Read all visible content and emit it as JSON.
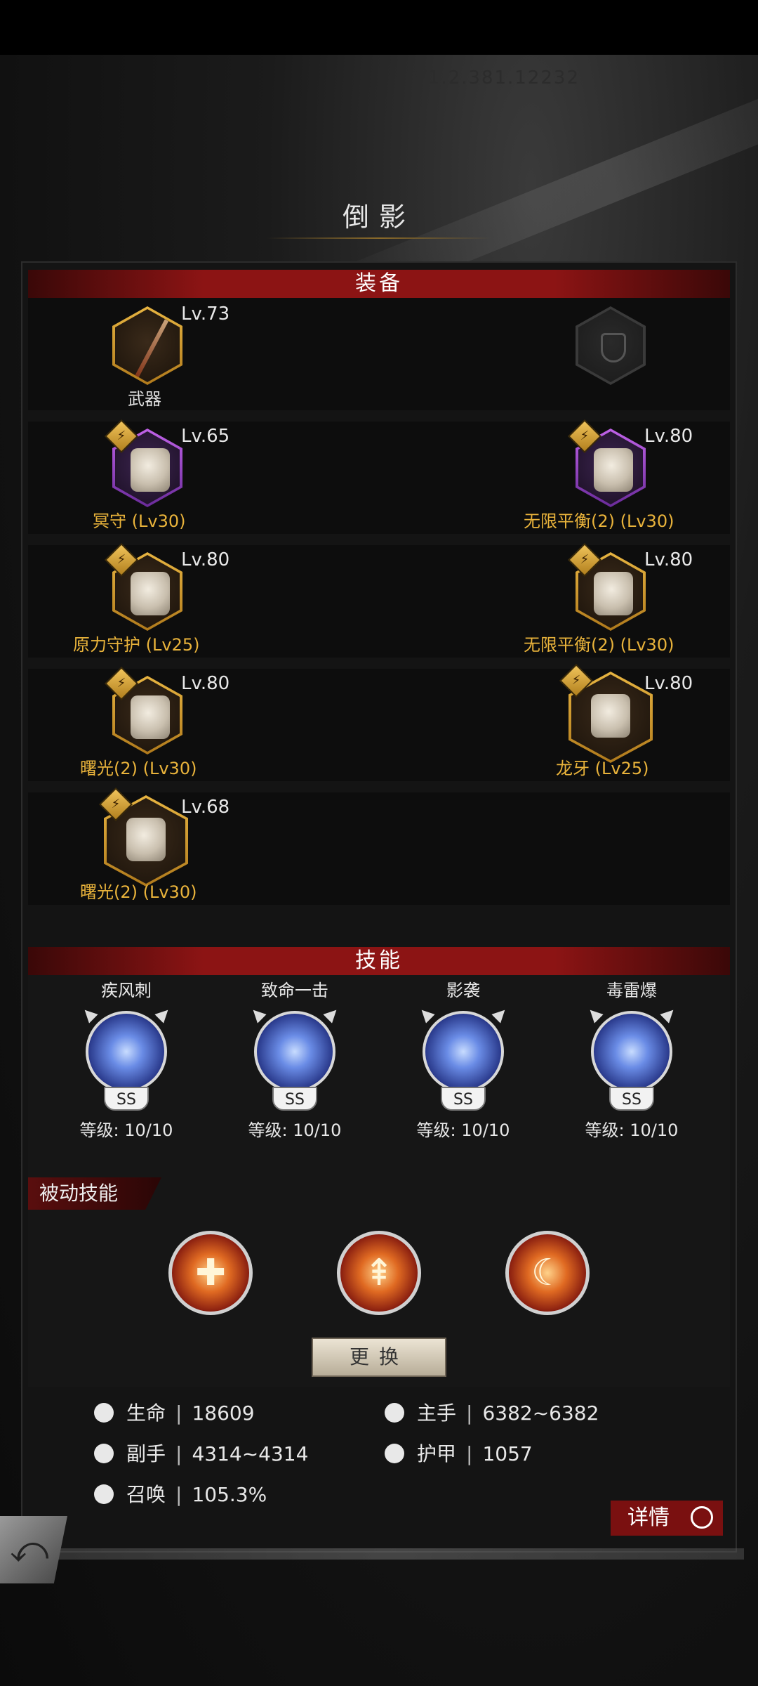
{
  "header": {
    "faint_text": "V1.2.381.12232",
    "title": "倒影"
  },
  "equipment": {
    "header": "装备",
    "slots": [
      {
        "level": "Lv.73",
        "name": "武器",
        "rarity": "gold",
        "icon": "katana-weapon"
      },
      {
        "level": "",
        "name": "",
        "rarity": "empty",
        "icon": "shield-slot-icon"
      },
      {
        "level": "Lv.65",
        "name": "冥守 (Lv30)",
        "rarity": "purple",
        "icon": "helmet"
      },
      {
        "level": "Lv.80",
        "name": "无限平衡(2) (Lv30)",
        "rarity": "purple",
        "icon": "chest-armor"
      },
      {
        "level": "Lv.80",
        "name": "原力守护 (Lv25)",
        "rarity": "gold",
        "icon": "gauntlet"
      },
      {
        "level": "Lv.80",
        "name": "无限平衡(2) (Lv30)",
        "rarity": "gold",
        "icon": "leg-armor"
      },
      {
        "level": "Lv.80",
        "name": "曙光(2) (Lv30)",
        "rarity": "gold",
        "icon": "necklace"
      },
      {
        "level": "Lv.80",
        "name": "龙牙 (Lv25)",
        "rarity": "gold",
        "icon": "belt"
      },
      {
        "level": "Lv.68",
        "name": "曙光(2) (Lv30)",
        "rarity": "gold",
        "icon": "cape"
      }
    ]
  },
  "skills": {
    "header": "技能",
    "active": [
      {
        "name": "疾风刺",
        "grade": "SS",
        "level": "等级: 10/10"
      },
      {
        "name": "致命一击",
        "grade": "SS",
        "level": "等级: 10/10"
      },
      {
        "name": "影袭",
        "grade": "SS",
        "level": "等级: 10/10"
      },
      {
        "name": "毒雷爆",
        "grade": "SS",
        "level": "等级: 10/10"
      }
    ],
    "passive_label": "被动技能",
    "passive": [
      {
        "icon": "cross-emblem-icon",
        "glyph": "✚"
      },
      {
        "icon": "spikes-icon",
        "glyph": "⇞"
      },
      {
        "icon": "elements-icon",
        "glyph": "☾"
      }
    ],
    "swap_label": "更换"
  },
  "stats": {
    "life_label": "生命",
    "life_value": "18609",
    "main_label": "主手",
    "main_value": "6382~6382",
    "off_label": "副手",
    "off_value": "4314~4314",
    "armor_label": "护甲",
    "armor_value": "1057",
    "summon_label": "召唤",
    "summon_value": "105.3%",
    "separator": "|"
  },
  "buttons": {
    "detail": "详情",
    "back_glyph": "⤺"
  }
}
